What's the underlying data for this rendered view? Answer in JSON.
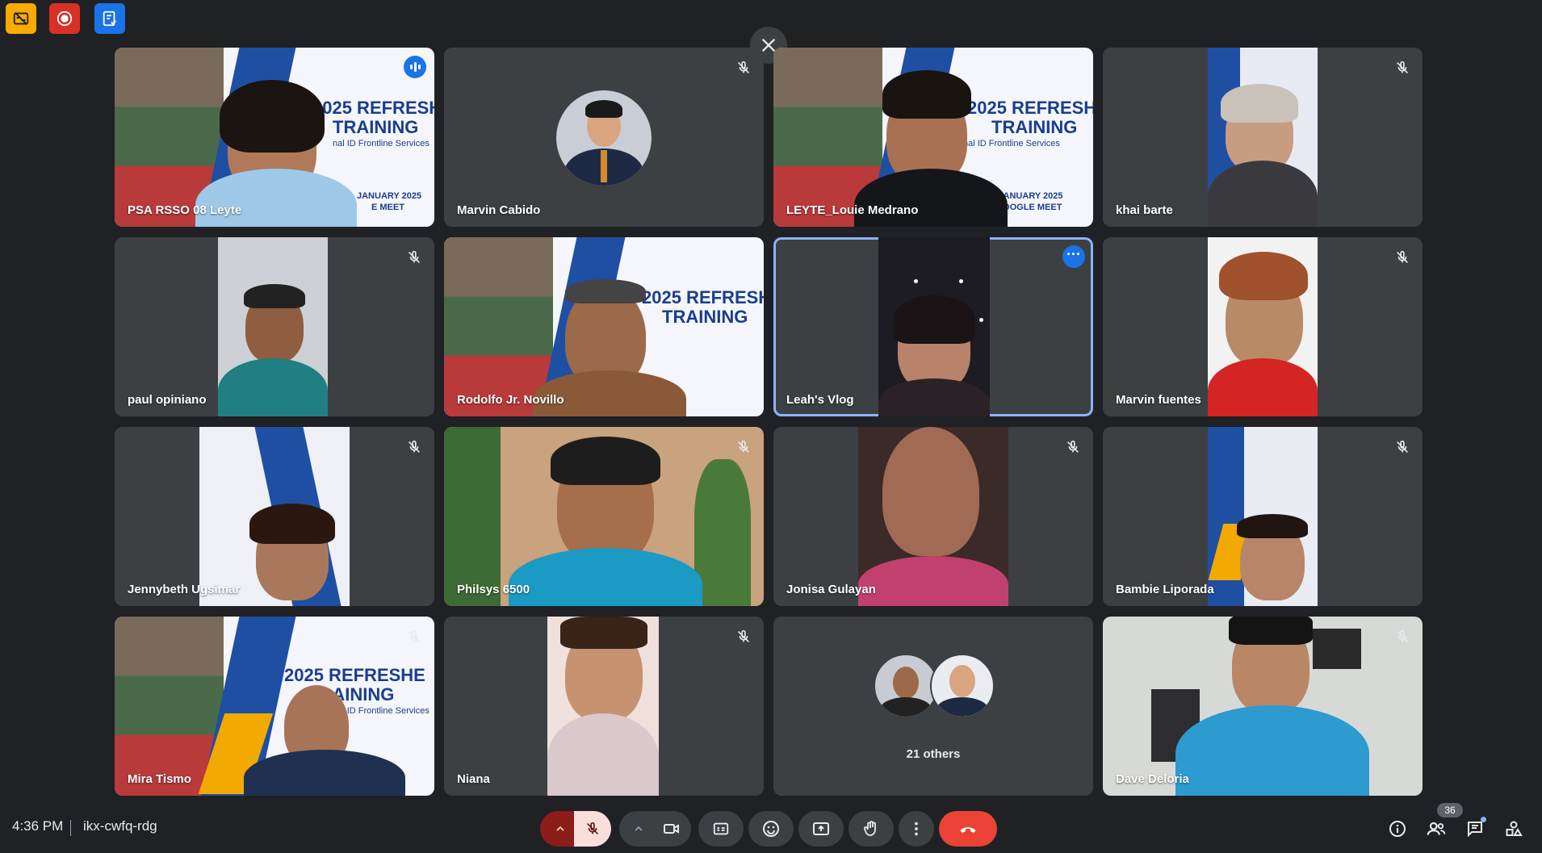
{
  "top_left": {
    "icons": [
      "no-captions-icon",
      "record-icon",
      "activities-icon"
    ]
  },
  "tiles": [
    {
      "name": "PSA RSSO 08 Leyte",
      "state": "speaking"
    },
    {
      "name": "Marvin Cabido",
      "state": "muted"
    },
    {
      "name": "LEYTE_Louie Medrano",
      "state": "none"
    },
    {
      "name": "khai barte",
      "state": "muted"
    },
    {
      "name": "paul opiniano",
      "state": "muted"
    },
    {
      "name": "Rodolfo Jr. Novillo",
      "state": "none"
    },
    {
      "name": "Leah's Vlog",
      "state": "pinned"
    },
    {
      "name": "Marvin fuentes",
      "state": "muted"
    },
    {
      "name": "Jennybeth Ugsimar",
      "state": "muted"
    },
    {
      "name": "Philsys 6500",
      "state": "muted"
    },
    {
      "name": "Jonisa Gulayan",
      "state": "muted"
    },
    {
      "name": "Bambie Liporada",
      "state": "muted"
    },
    {
      "name": "Mira Tismo",
      "state": "muted"
    },
    {
      "name": "Niana",
      "state": "muted"
    },
    {
      "name": "21 others",
      "state": "group"
    },
    {
      "name": "Dave Deloria",
      "state": "muted"
    }
  ],
  "banner": {
    "title_line1": "2025 REFRESHE",
    "title_line2": "TRAINING",
    "subtitle": "nal ID Frontline Services",
    "date_line1": "JANUARY 2025",
    "date_line2": "E MEET",
    "date_alt_line1": "TO 17 JANUARY 2025",
    "date_alt_line2": "A GOOGLE MEET"
  },
  "bottom_bar": {
    "time": "4:36 PM",
    "meeting_code": "ikx-cwfq-rdg",
    "participants_count": "36"
  },
  "colors": {
    "background": "#202124",
    "tile": "#3c4043",
    "accent_blue": "#1a73e8",
    "end_call_red": "#ea4335",
    "active_border": "#8ab4f8"
  }
}
